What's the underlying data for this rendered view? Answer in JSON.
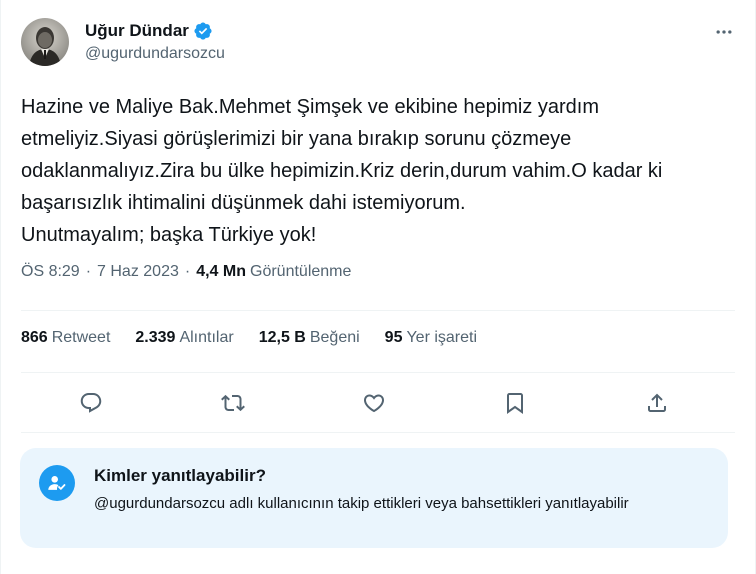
{
  "colors": {
    "accent": "#1d9bf0",
    "text_primary": "#0f1419",
    "text_secondary": "#536471",
    "divider": "#eff3f4",
    "reply_box_bg": "#eaf5fd"
  },
  "author": {
    "display_name": "Uğur Dündar",
    "handle": "@ugurdundarsozcu",
    "verified": true,
    "avatar_icon": "profile-photo"
  },
  "more_icon": "more-horizontal-icon",
  "tweet": {
    "text": "Hazine ve Maliye Bak.Mehmet Şimşek ve ekibine hepimiz yardım etmeliyiz.Siyasi görüşlerimizi bir yana bırakıp sorunu çözmeye odaklanmalıyız.Zira bu ülke hepimizin.Kriz derin,durum vahim.O kadar ki başarısızlık ihtimalini düşünmek dahi istemiyorum.\nUnutmayalım; başka Türkiye yok!"
  },
  "meta": {
    "time": "ÖS 8:29",
    "separator": "·",
    "date": "7 Haz 2023",
    "views_count": "4,4 Mn",
    "views_label": "Görüntülenme"
  },
  "stats": {
    "retweets": {
      "count": "866",
      "label": "Retweet"
    },
    "quotes": {
      "count": "2.339",
      "label": "Alıntılar"
    },
    "likes": {
      "count": "12,5 B",
      "label": "Beğeni"
    },
    "bookmarks": {
      "count": "95",
      "label": "Yer işareti"
    }
  },
  "actions": [
    {
      "name": "reply",
      "icon": "reply-icon"
    },
    {
      "name": "retweet",
      "icon": "retweet-icon"
    },
    {
      "name": "like",
      "icon": "heart-icon"
    },
    {
      "name": "bookmark",
      "icon": "bookmark-icon"
    },
    {
      "name": "share",
      "icon": "share-icon"
    }
  ],
  "reply_restriction": {
    "title": "Kimler yanıtlayabilir?",
    "description": "@ugurdundarsozcu adlı kullanıcının takip ettikleri veya bahsettikleri yanıtlayabilir",
    "icon": "user-check-icon"
  }
}
